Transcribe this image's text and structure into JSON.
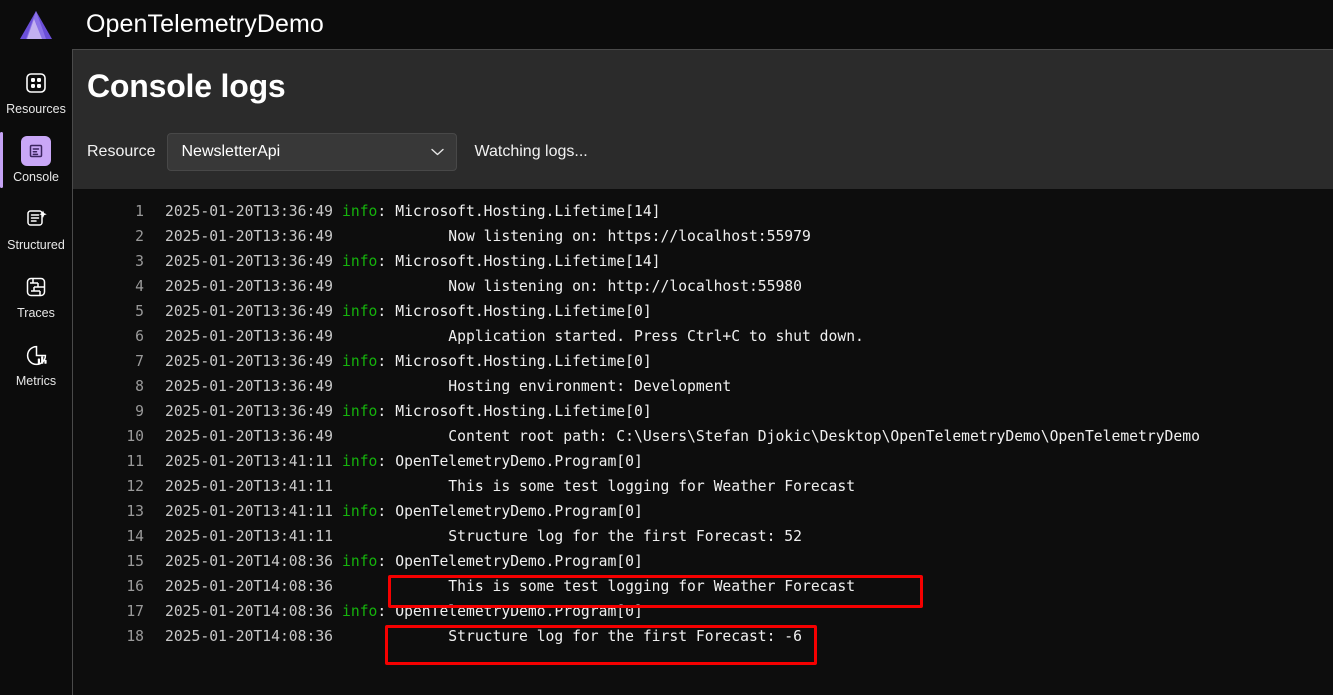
{
  "header": {
    "app_title": "OpenTelemetryDemo",
    "logo_icon": "aspire-logo-icon"
  },
  "sidebar": {
    "items": [
      {
        "label": "Resources",
        "icon": "resources-grid-icon",
        "active": false
      },
      {
        "label": "Console",
        "icon": "console-log-icon",
        "active": true
      },
      {
        "label": "Structured",
        "icon": "structured-logs-icon",
        "active": false
      },
      {
        "label": "Traces",
        "icon": "traces-icon",
        "active": false
      },
      {
        "label": "Metrics",
        "icon": "metrics-chart-icon",
        "active": false
      }
    ]
  },
  "main": {
    "page_title": "Console logs",
    "resource_label": "Resource",
    "resource_selected": "NewsletterApi",
    "resource_dropdown_icon": "chevron-down-icon",
    "status_text": "Watching logs..."
  },
  "colors": {
    "accent_purple": "#c9a7f7",
    "info_green": "#15b30c",
    "highlight_red": "#f50000",
    "panel_bg": "#2b2b2b",
    "log_bg": "#0d0d0d"
  },
  "log": {
    "lines": [
      {
        "n": "1",
        "ts": "2025-01-20T13:36:49",
        "level": "info",
        "msg": "Microsoft.Hosting.Lifetime[14]"
      },
      {
        "n": "2",
        "ts": "2025-01-20T13:36:49",
        "level": "",
        "msg": "      Now listening on: https://localhost:55979"
      },
      {
        "n": "3",
        "ts": "2025-01-20T13:36:49",
        "level": "info",
        "msg": "Microsoft.Hosting.Lifetime[14]"
      },
      {
        "n": "4",
        "ts": "2025-01-20T13:36:49",
        "level": "",
        "msg": "      Now listening on: http://localhost:55980"
      },
      {
        "n": "5",
        "ts": "2025-01-20T13:36:49",
        "level": "info",
        "msg": "Microsoft.Hosting.Lifetime[0]"
      },
      {
        "n": "6",
        "ts": "2025-01-20T13:36:49",
        "level": "",
        "msg": "      Application started. Press Ctrl+C to shut down."
      },
      {
        "n": "7",
        "ts": "2025-01-20T13:36:49",
        "level": "info",
        "msg": "Microsoft.Hosting.Lifetime[0]"
      },
      {
        "n": "8",
        "ts": "2025-01-20T13:36:49",
        "level": "",
        "msg": "      Hosting environment: Development"
      },
      {
        "n": "9",
        "ts": "2025-01-20T13:36:49",
        "level": "info",
        "msg": "Microsoft.Hosting.Lifetime[0]"
      },
      {
        "n": "10",
        "ts": "2025-01-20T13:36:49",
        "level": "",
        "msg": "      Content root path: C:\\Users\\Stefan Djokic\\Desktop\\OpenTelemetryDemo\\OpenTelemetryDemo"
      },
      {
        "n": "11",
        "ts": "2025-01-20T13:41:11",
        "level": "info",
        "msg": "OpenTelemetryDemo.Program[0]"
      },
      {
        "n": "12",
        "ts": "2025-01-20T13:41:11",
        "level": "",
        "msg": "      This is some test logging for Weather Forecast"
      },
      {
        "n": "13",
        "ts": "2025-01-20T13:41:11",
        "level": "info",
        "msg": "OpenTelemetryDemo.Program[0]"
      },
      {
        "n": "14",
        "ts": "2025-01-20T13:41:11",
        "level": "",
        "msg": "      Structure log for the first Forecast: 52"
      },
      {
        "n": "15",
        "ts": "2025-01-20T14:08:36",
        "level": "info",
        "msg": "OpenTelemetryDemo.Program[0]"
      },
      {
        "n": "16",
        "ts": "2025-01-20T14:08:36",
        "level": "",
        "msg": "      This is some test logging for Weather Forecast"
      },
      {
        "n": "17",
        "ts": "2025-01-20T14:08:36",
        "level": "info",
        "msg": "OpenTelemetryDemo.Program[0]"
      },
      {
        "n": "18",
        "ts": "2025-01-20T14:08:36",
        "level": "",
        "msg": "      Structure log for the first Forecast: -6"
      }
    ]
  },
  "annotations": {
    "boxes": [
      {
        "target_line": "16",
        "note": "red-highlight-box"
      },
      {
        "target_line": "18",
        "note": "red-highlight-box"
      }
    ]
  }
}
